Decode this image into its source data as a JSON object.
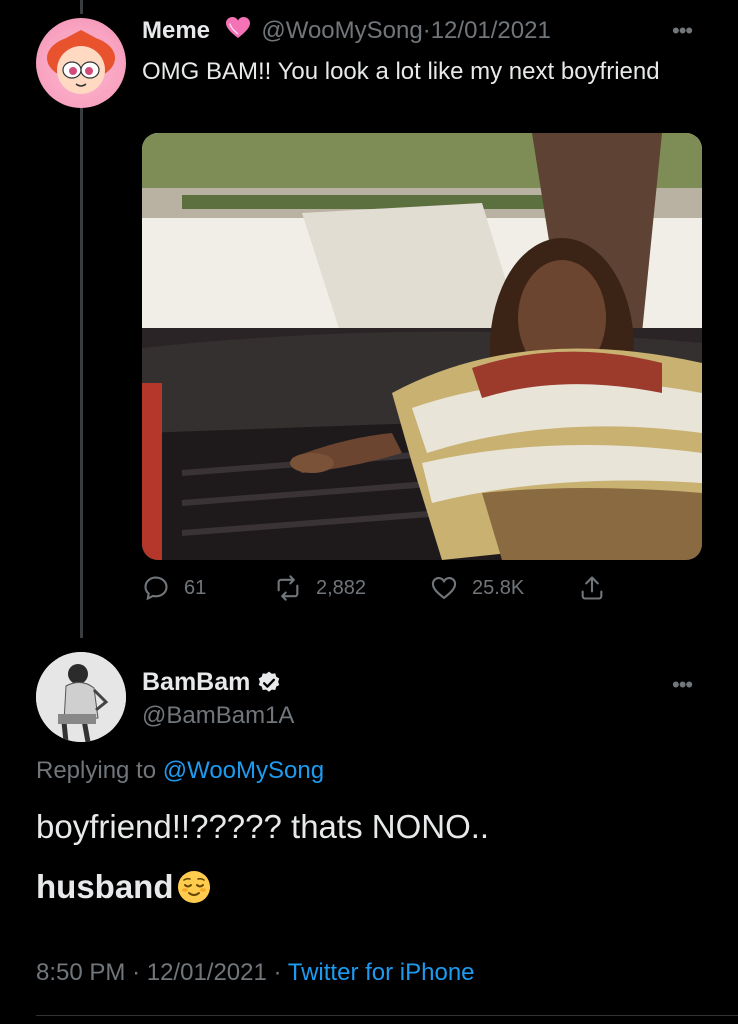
{
  "tweet1": {
    "name": "Meme",
    "handle": "@WooMySong",
    "separator": "·",
    "date": "12/01/2021",
    "text": "OMG BAM!! You look a lot like my next boyfriend",
    "replies": "61",
    "retweets": "2,882",
    "likes": "25.8K",
    "name_icon": "pink-heart-icon"
  },
  "tweet2": {
    "name": "BamBam",
    "handle": "@BamBam1A",
    "replying_prefix": "Replying to",
    "replying_to": "@WooMySong",
    "line1": "boyfriend!!????? thats NONO..",
    "line2": "husband",
    "time": "8:50 PM",
    "separator": "·",
    "date": "12/01/2021",
    "dot2": "·",
    "source": "Twitter for iPhone"
  },
  "colors": {
    "background": "#000000",
    "text": "#e7e9ea",
    "secondary": "#71767b",
    "link": "#1d9bf0"
  }
}
